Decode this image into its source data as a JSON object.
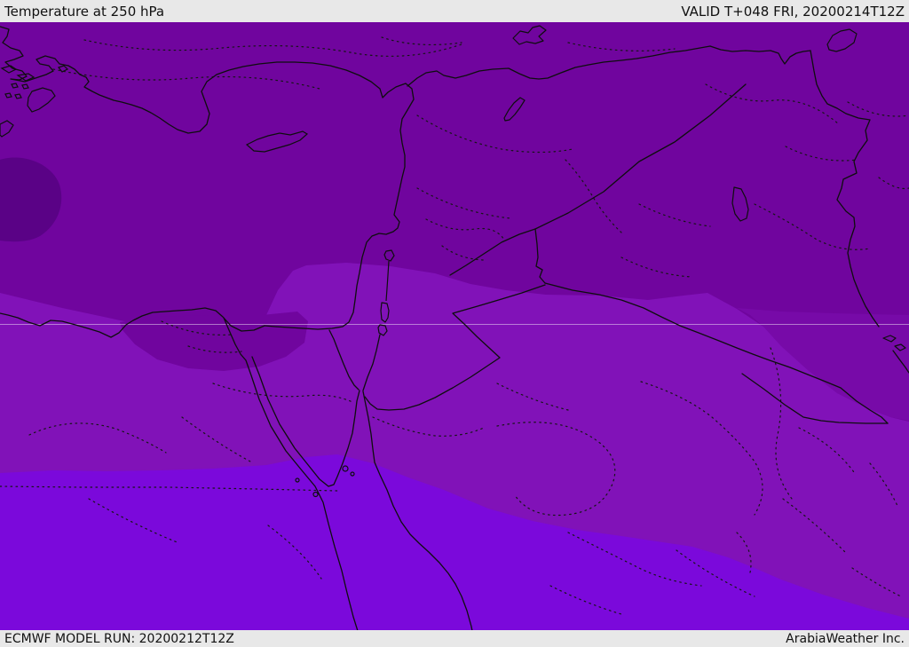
{
  "header": {
    "title": "Temperature at 250 hPa",
    "valid_label": "VALID T+048 FRI, 20200214T12Z"
  },
  "footer": {
    "model_run_label": "ECMWF MODEL RUN: 20200212T12Z",
    "credit_label": "ArabiaWeather Inc."
  },
  "map": {
    "colors": {
      "band_coldest": "#5A0286",
      "band_cold": "#70059E",
      "band_mid": "#770AA8",
      "band_warm": "#8112B8",
      "band_warmest": "#7B09DB",
      "line": "#0E0E0E",
      "graticule": "rgba(255,255,255,0.45)",
      "bar_background": "#E8E8E8",
      "bar_text": "#111111"
    }
  }
}
